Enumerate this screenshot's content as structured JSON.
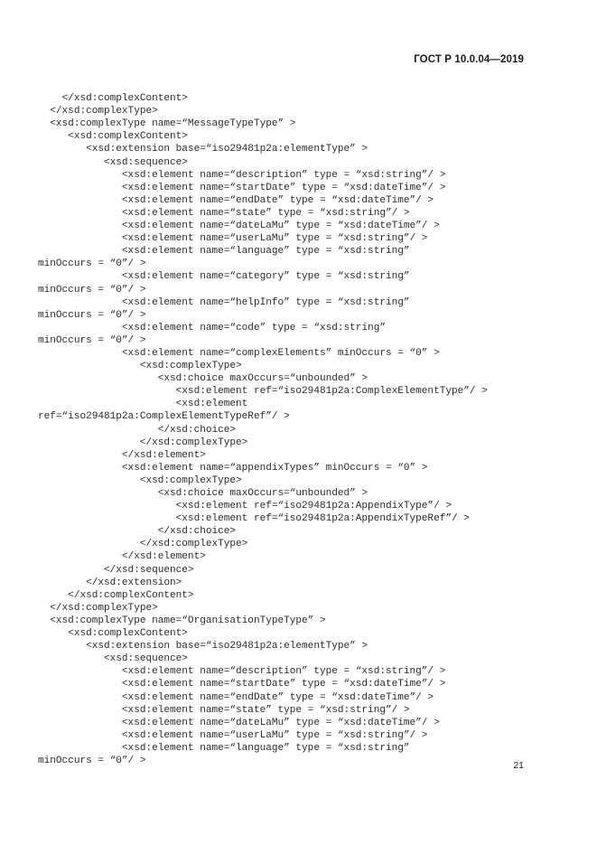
{
  "page": {
    "running_head": "ГОСТ Р 10.0.04—2019",
    "folio": "21",
    "background_color": "#ffffff",
    "text_color": "#2b2b2b"
  },
  "code_listing": {
    "language": "xsd",
    "lines": [
      "    </xsd:complexContent>",
      "  </xsd:complexType>",
      "  <xsd:complexType name=“MessageTypeType” >",
      "     <xsd:complexContent>",
      "        <xsd:extension base=“iso29481p2a:elementType” >",
      "           <xsd:sequence>",
      "              <xsd:element name=“description” type = “xsd:string”/ >",
      "              <xsd:element name=“startDate” type = “xsd:dateTime”/ >",
      "              <xsd:element name=“endDate” type = “xsd:dateTime”/ >",
      "              <xsd:element name=“state” type = “xsd:string”/ >",
      "              <xsd:element name=“dateLaMu” type = “xsd:dateTime”/ >",
      "              <xsd:element name=“userLaMu” type = “xsd:string”/ >",
      "              <xsd:element name=“language” type = “xsd:string”",
      "minOccurs = “0”/ >",
      "              <xsd:element name=“category” type = “xsd:string”",
      "minOccurs = “0”/ >",
      "              <xsd:element name=“helpInfo” type = “xsd:string”",
      "minOccurs = “0”/ >",
      "              <xsd:element name=“code” type = “xsd:string”",
      "minOccurs = “0”/ >",
      "              <xsd:element name=“complexElements” minOccurs = “0” >",
      "                 <xsd:complexType>",
      "                    <xsd:choice maxOccurs=“unbounded” >",
      "                       <xsd:element ref=“iso29481p2a:ComplexElementType”/ >",
      "                       <xsd:element",
      "ref=“iso29481p2a:ComplexElementTypeRef”/ >",
      "                    </xsd:choice>",
      "                 </xsd:complexType>",
      "              </xsd:element>",
      "              <xsd:element name=“appendixTypes” minOccurs = “0” >",
      "                 <xsd:complexType>",
      "                    <xsd:choice maxOccurs=“unbounded” >",
      "                       <xsd:element ref=“iso29481p2a:AppendixType”/ >",
      "                       <xsd:element ref=“iso29481p2a:AppendixTypeRef”/ >",
      "                    </xsd:choice>",
      "                 </xsd:complexType>",
      "              </xsd:element>",
      "           </xsd:sequence>",
      "        </xsd:extension>",
      "     </xsd:complexContent>",
      "  </xsd:complexType>",
      "  <xsd:complexType name=“OrganisationTypeType” >",
      "     <xsd:complexContent>",
      "        <xsd:extension base=“iso29481p2a:elementType” >",
      "           <xsd:sequence>",
      "              <xsd:element name=“description” type = “xsd:string”/ >",
      "              <xsd:element name=“startDate” type = “xsd:dateTime”/ >",
      "              <xsd:element name=“endDate” type = “xsd:dateTime”/ >",
      "              <xsd:element name=“state” type = “xsd:string”/ >",
      "              <xsd:element name=“dateLaMu” type = “xsd:dateTime”/ >",
      "              <xsd:element name=“userLaMu” type = “xsd:string”/ >",
      "              <xsd:element name=“language” type = “xsd:string”",
      "minOccurs = “0”/ >"
    ]
  }
}
